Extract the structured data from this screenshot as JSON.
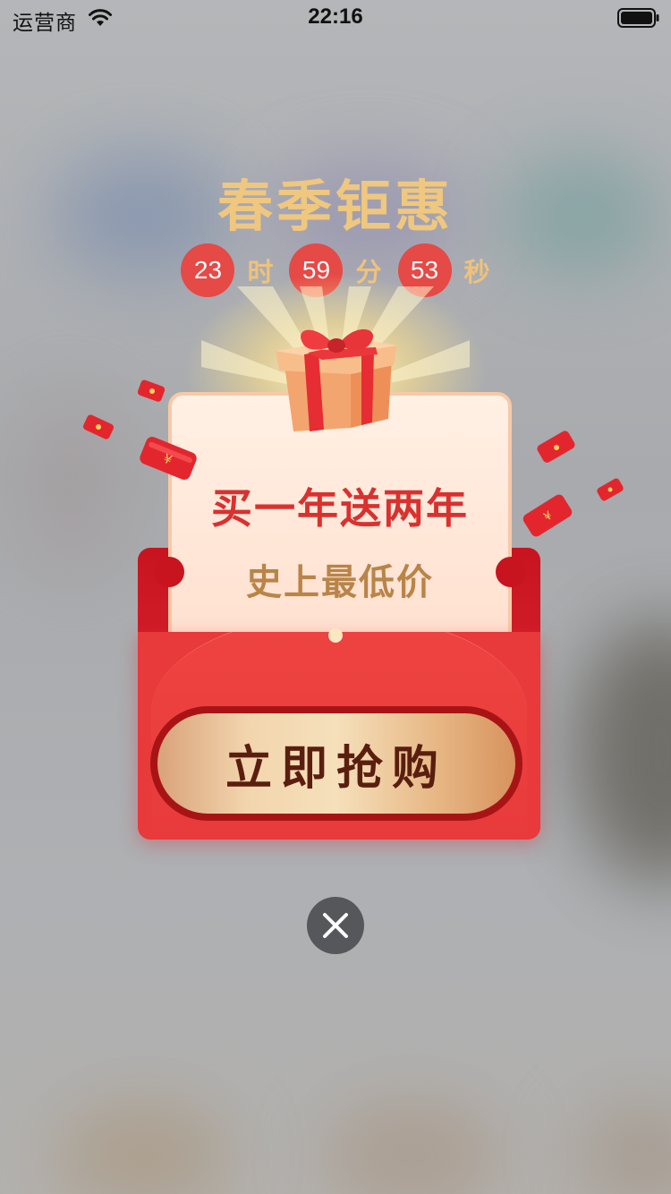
{
  "status_bar": {
    "carrier": "运营商",
    "time": "22:16"
  },
  "promo": {
    "title": "春季钜惠",
    "countdown": {
      "hours": "23",
      "hours_unit": "时",
      "minutes": "59",
      "minutes_unit": "分",
      "seconds": "53",
      "seconds_unit": "秒"
    },
    "headline": "买一年送两年",
    "subheadline": "史上最低价",
    "buy_label": "立即抢购"
  },
  "icons": {
    "wifi": "wifi-icon",
    "battery": "battery-icon",
    "gift": "gift-box-icon",
    "close": "close-icon",
    "red_packet": "red-packet-icon"
  },
  "colors": {
    "title": "#f0c77e",
    "countdown_bg": "#e54a46",
    "envelope_red": "#e8393b",
    "headline": "#d9312f",
    "subheadline": "#b98448",
    "button_text": "#5a1e0f"
  }
}
